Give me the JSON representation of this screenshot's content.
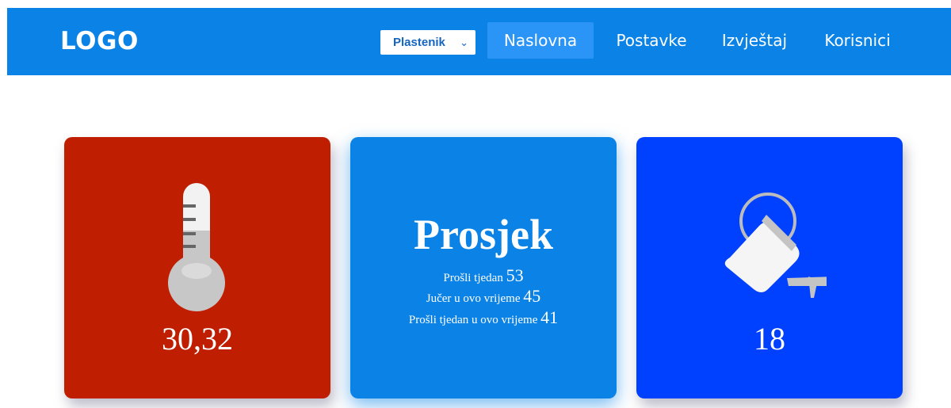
{
  "header": {
    "logo": "LOGO",
    "select": {
      "selected": "Plastenik"
    },
    "nav": [
      {
        "label": "Naslovna",
        "active": true
      },
      {
        "label": "Postavke"
      },
      {
        "label": "Izvještaj"
      },
      {
        "label": "Korisnici"
      }
    ]
  },
  "cards": {
    "temperature": {
      "icon": "thermometer-icon",
      "value": "30,32"
    },
    "average": {
      "title": "Prosjek",
      "lines": [
        {
          "label": "Prošli tjedan",
          "value": "53"
        },
        {
          "label": "Jučer u ovo vrijeme",
          "value": "45"
        },
        {
          "label": "Prošli tjedan u ovo vrijeme",
          "value": "41"
        }
      ]
    },
    "watering": {
      "icon": "watering-can-icon",
      "value": "18"
    }
  },
  "colors": {
    "nav": "#0a82e6",
    "nav_active": "#2a95f7",
    "temp_card": "#bf1e00",
    "avg_card": "#0a82e6",
    "water_card": "#0041ff"
  }
}
